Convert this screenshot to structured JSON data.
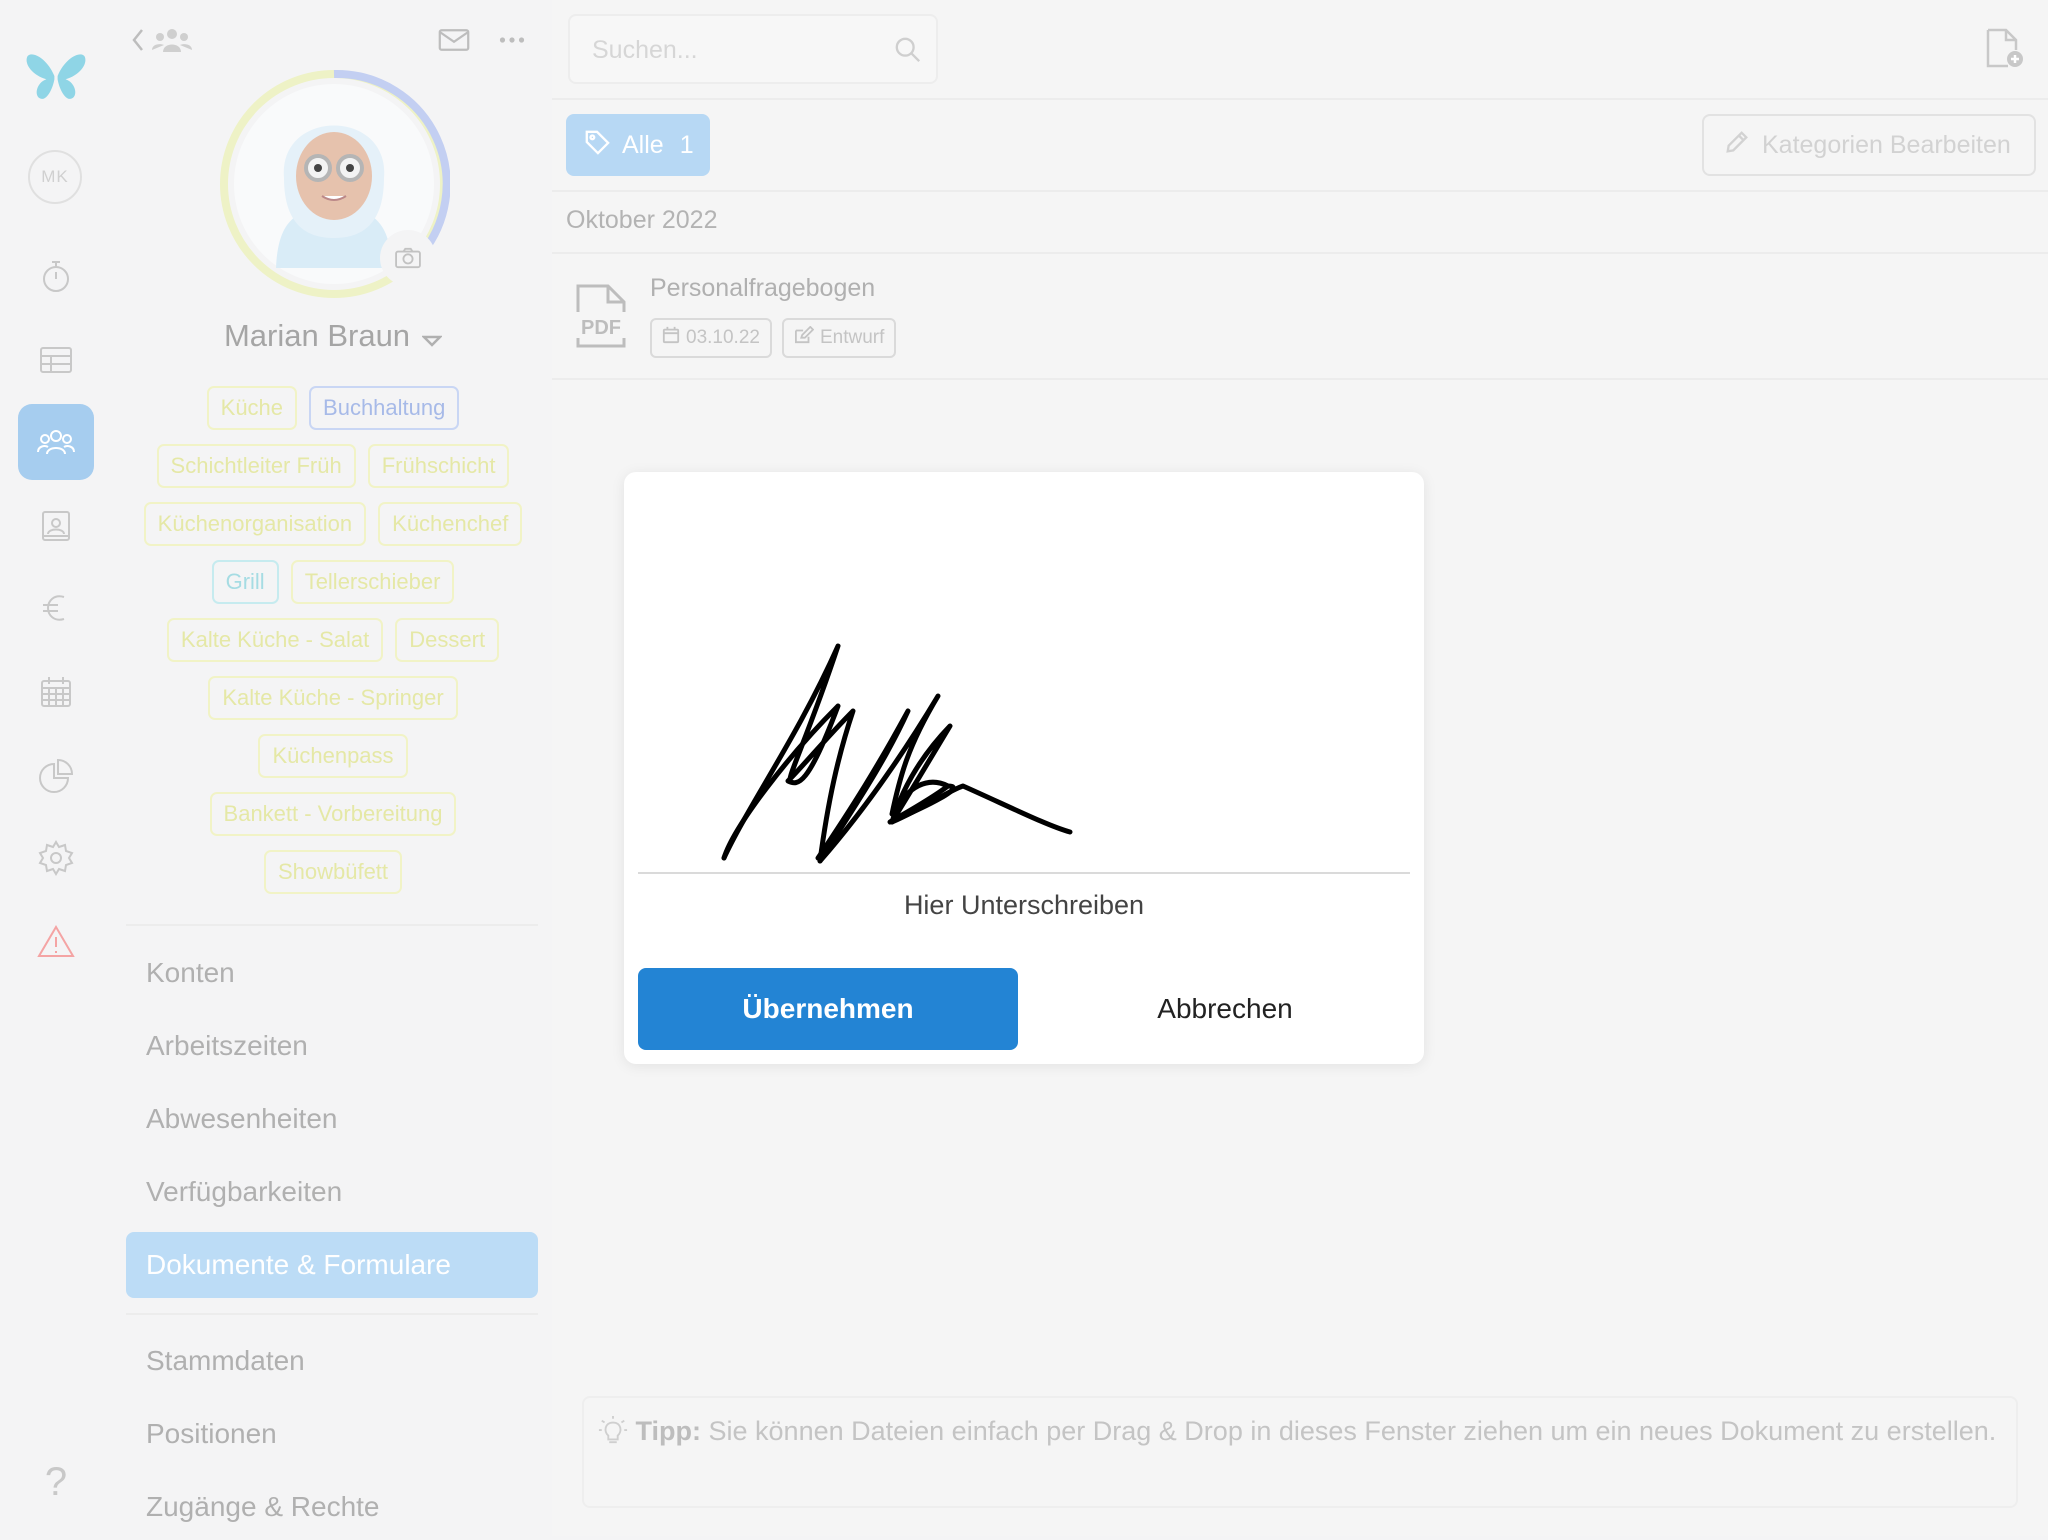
{
  "colors": {
    "primary": "#2384d4",
    "active_light": "#a6cdef",
    "tag_yellow": "#e5e8a6",
    "tag_blue": "#a7bae8",
    "tag_teal": "#a6dce3",
    "warning": "#f4a4a4"
  },
  "rail": {
    "avatar_initials": "MK",
    "items": [
      {
        "icon": "butterfly-logo-icon"
      },
      {
        "icon": "stopwatch-icon"
      },
      {
        "icon": "table-icon"
      },
      {
        "icon": "team-icon",
        "active": true
      },
      {
        "icon": "contact-card-icon"
      },
      {
        "icon": "euro-icon"
      },
      {
        "icon": "calendar-icon"
      },
      {
        "icon": "pie-chart-icon"
      },
      {
        "icon": "settings-gear-icon"
      },
      {
        "icon": "warning-icon"
      },
      {
        "icon": "help-icon"
      }
    ],
    "help_glyph": "?"
  },
  "profile": {
    "name": "Marian Braun",
    "tags": [
      [
        "Küche",
        "Buchhaltung"
      ],
      [
        "Schichtleiter Früh",
        "Frühschicht"
      ],
      [
        "Küchenorganisation",
        "Küchenchef"
      ],
      [
        "Grill",
        "Tellerschieber"
      ],
      [
        "Kalte Küche - Salat",
        "Dessert"
      ],
      [
        "Kalte Küche - Springer"
      ],
      [
        "Küchenpass"
      ],
      [
        "Bankett - Vorbereitung"
      ],
      [
        "Showbüfett"
      ]
    ],
    "nav": [
      "Konten",
      "Arbeitszeiten",
      "Abwesenheiten",
      "Verfügbarkeiten",
      "Dokumente & Formulare",
      "Stammdaten",
      "Positionen",
      "Zugänge & Rechte"
    ],
    "nav_active": "Dokumente & Formulare"
  },
  "main": {
    "search_placeholder": "Suchen...",
    "filter": {
      "label": "Alle",
      "count": "1"
    },
    "edit_categories_label": "Kategorien Bearbeiten",
    "month_header": "Oktober 2022",
    "document": {
      "type_label": "PDF",
      "title": "Personalfragebogen",
      "date": "03.10.22",
      "status": "Entwurf"
    },
    "tip_label": "Tipp:",
    "tip_text": "Sie können Dateien einfach per Drag & Drop in dieses Fenster ziehen um ein neues Dokument zu erstellen."
  },
  "modal": {
    "caption": "Hier Unterschreiben",
    "apply_label": "Übernehmen",
    "cancel_label": "Abbrechen"
  }
}
